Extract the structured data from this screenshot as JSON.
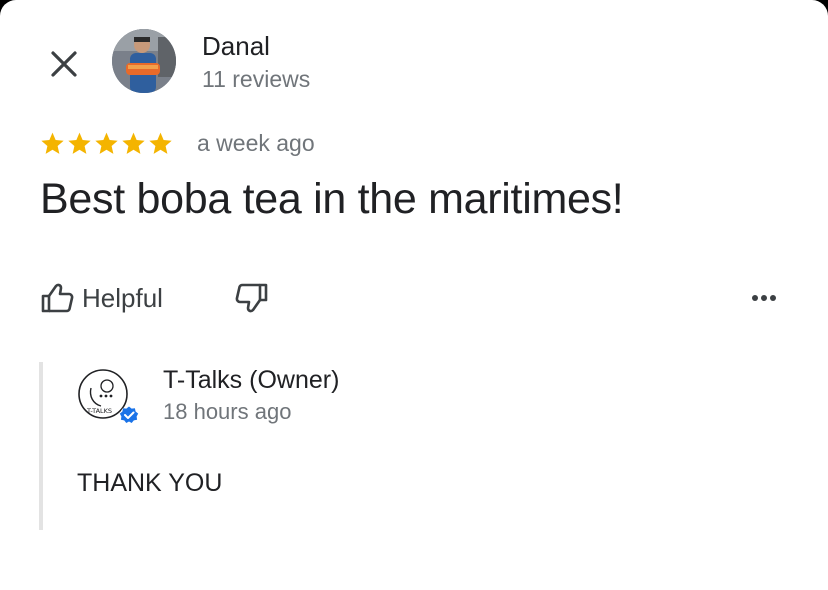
{
  "author": {
    "name": "Danal",
    "meta": "11 reviews"
  },
  "review": {
    "rating": 5,
    "max_rating": 5,
    "time": "a week ago",
    "text": "Best boba tea in the maritimes!"
  },
  "actions": {
    "helpful_label": "Helpful"
  },
  "reply": {
    "owner_name": "T-Talks (Owner)",
    "time": "18 hours ago",
    "text": "THANK YOU",
    "logo_text": "T-TALKS"
  },
  "colors": {
    "star": "#f4b400",
    "verified": "#1a73e8",
    "text_primary": "#202124",
    "text_secondary": "#70757a"
  },
  "icons": [
    "close-icon",
    "thumbs-up-icon",
    "thumbs-down-icon",
    "more-vert-icon",
    "verified-badge-icon"
  ]
}
